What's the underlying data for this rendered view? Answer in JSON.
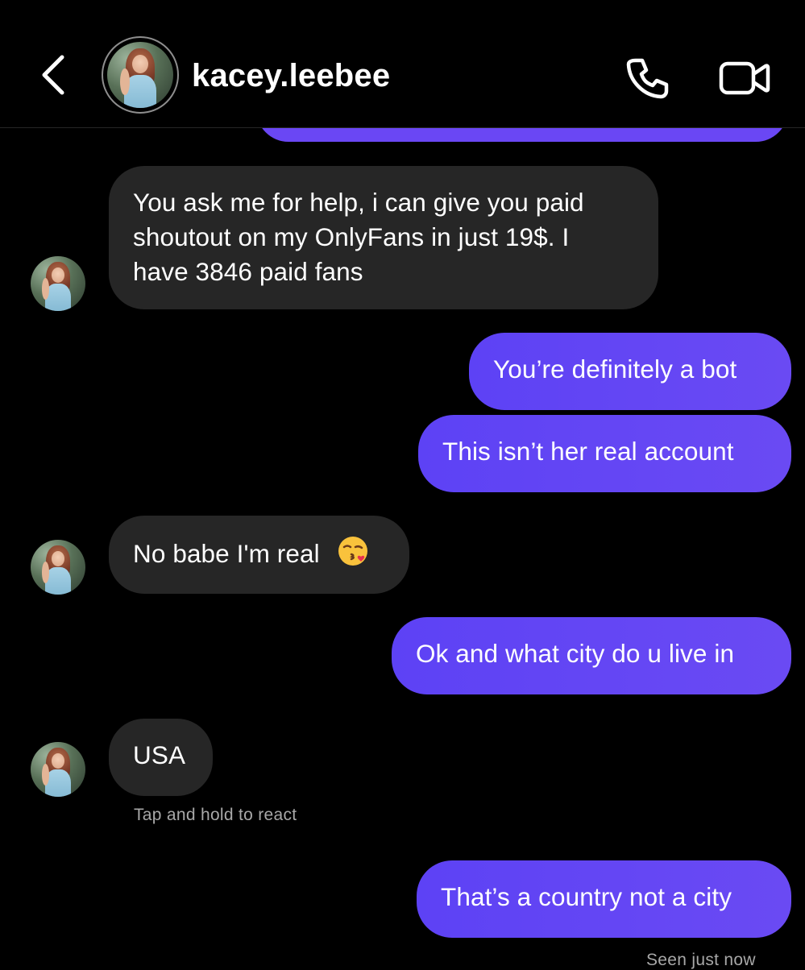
{
  "header": {
    "username": "kacey.leebee",
    "back_icon": "chevron-left-icon",
    "call_icon": "phone-icon",
    "video_icon": "video-camera-icon"
  },
  "messages": [
    {
      "from": "them",
      "text_lines": [
        "You ask me for help, i can give you paid",
        "shoutout on my OnlyFans in just 19$. I",
        "have 3846 paid fans"
      ]
    },
    {
      "from": "me",
      "text": "You’re definitely a bot"
    },
    {
      "from": "me",
      "text": "This isn’t her real account"
    },
    {
      "from": "them",
      "text": "No babe I'm real",
      "emoji": "face-blowing-kiss"
    },
    {
      "from": "me",
      "text": "Ok and what city do u live in"
    },
    {
      "from": "them",
      "text": "USA"
    },
    {
      "from": "me",
      "text": "That’s a country not a city"
    }
  ],
  "hint": "Tap and hold to react",
  "status": "Seen just now",
  "colors": {
    "background": "#000000",
    "incoming_bubble": "#262626",
    "outgoing_bubble": "#5d42f5",
    "secondary_text": "#a8a8a8"
  }
}
